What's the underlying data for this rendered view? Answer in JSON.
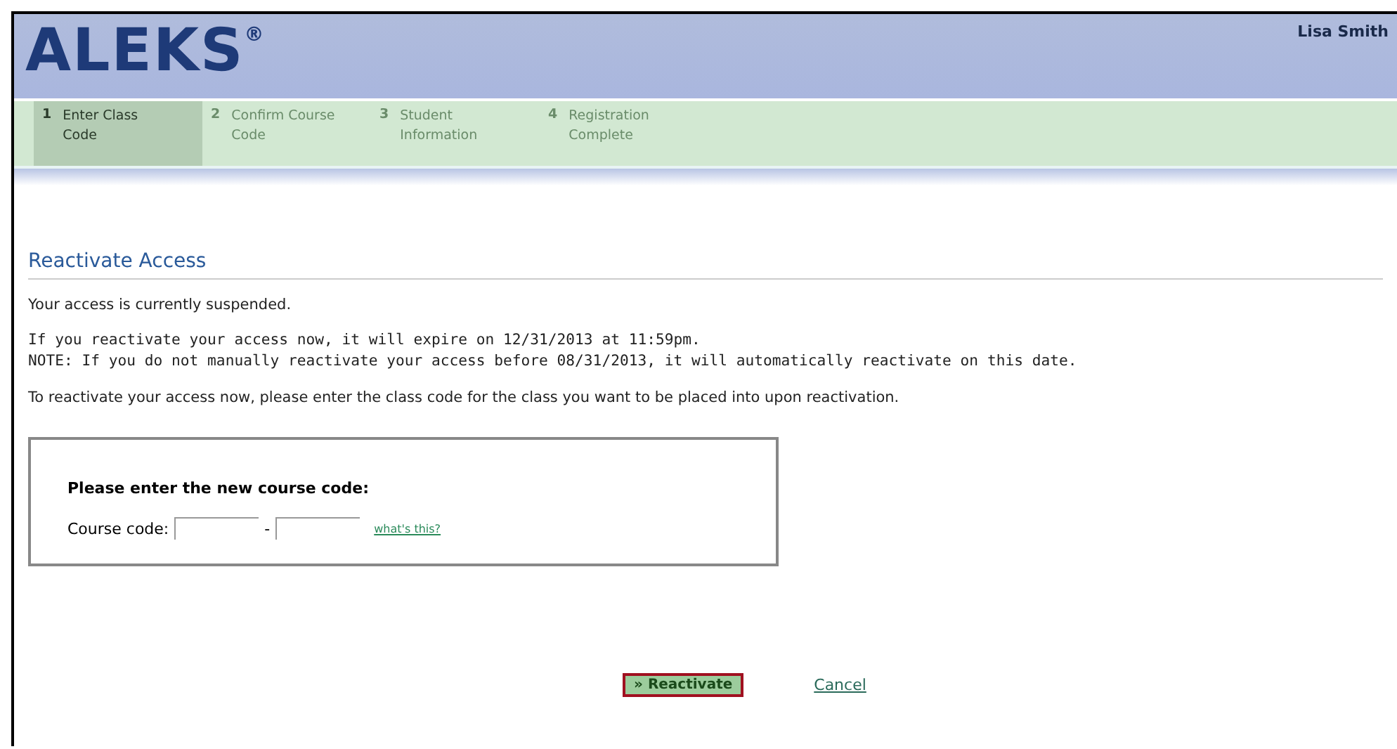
{
  "header": {
    "logo": "ALEKS$^{®}$",
    "user_name": "Lisa Smith"
  },
  "steps": [
    {
      "number": "1",
      "label": "Enter Class Code",
      "selected": true
    },
    {
      "number": "2",
      "label": "Confirm Course Code",
      "selected": false
    },
    {
      "number": "3",
      "label": "Student Information",
      "selected": false
    },
    {
      "number": "4",
      "label": "Registration Complete",
      "selected": false
    }
  ],
  "heading": "Reactivate Access",
  "status_text": "Your access is currently suspended.",
  "expiry_lines": [
    "If you reactivate your access now, it will expire on 12/31/2013 at 11:59pm.",
    "NOTE: If you do not manually reactivate your access before 08/31/2013, it will automatically reactivate on this date."
  ],
  "instructions": "To reactivate your access now, please enter the class code for the class you want to be placed into upon reactivation.",
  "code_panel": {
    "title": "Please enter the new course code:",
    "label": "Course code:",
    "separator": "-",
    "help_link": "what's this?"
  },
  "buttons": {
    "primary": "» Reactivate",
    "cancel": "Cancel"
  }
}
